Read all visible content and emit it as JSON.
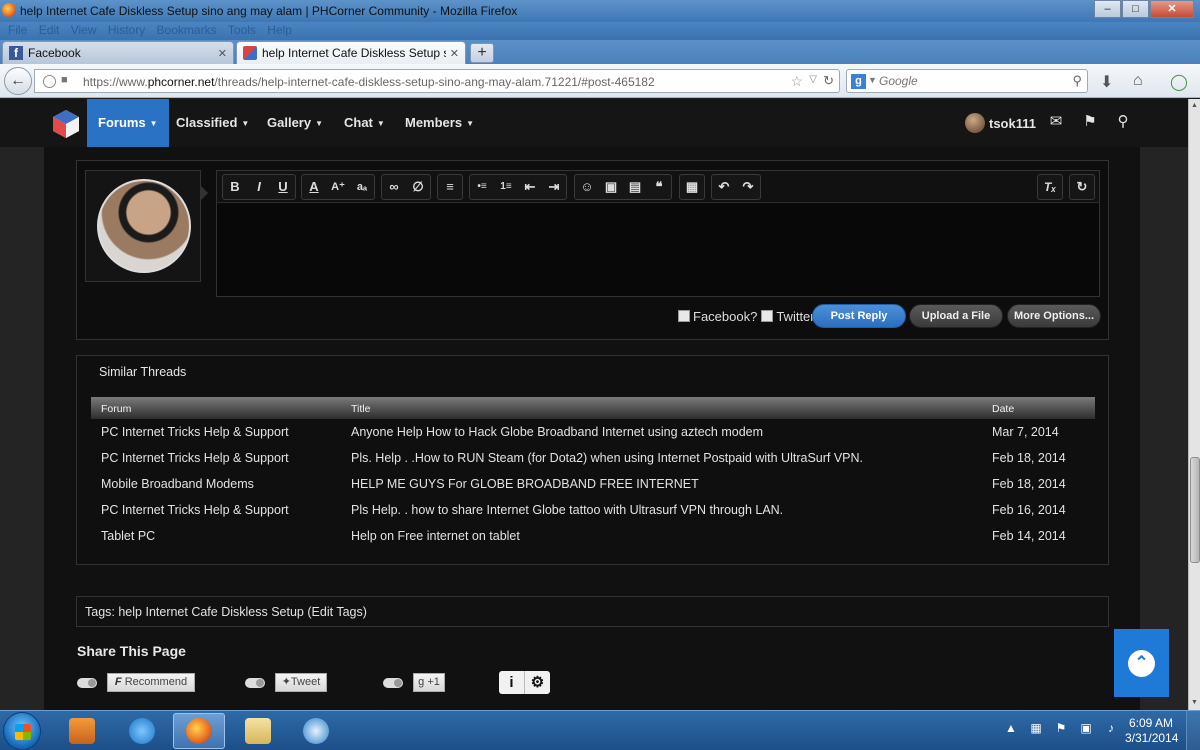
{
  "window": {
    "title": "help Internet Cafe Diskless Setup sino ang may alam | PHCorner Community - Mozilla Firefox",
    "controls": [
      "–",
      "□",
      "✕"
    ]
  },
  "menubar": [
    "File",
    "Edit",
    "View",
    "History",
    "Bookmarks",
    "Tools",
    "Help"
  ],
  "tabs": [
    {
      "label": "Facebook",
      "close": "✕"
    },
    {
      "label": "help Internet Cafe Diskless Setup sino...",
      "close": "✕"
    }
  ],
  "newtab_label": "+",
  "urlbar": {
    "prefix": "https://www.",
    "domain": "phcorner.net",
    "path": "/threads/help-internet-cafe-diskless-setup-sino-ang-may-alam.71221/#post-465182"
  },
  "search": {
    "placeholder": "Google",
    "engine_letter": "g"
  },
  "sitenav": {
    "items": [
      {
        "label": "Forums",
        "caret": "▼"
      },
      {
        "label": "Classified",
        "caret": "▼"
      },
      {
        "label": "Gallery",
        "caret": "▼"
      },
      {
        "label": "Chat",
        "caret": "▼"
      },
      {
        "label": "Members",
        "caret": "▼"
      }
    ],
    "username": "tsok111"
  },
  "editor": {
    "toolbar": {
      "bold": "B",
      "italic": "I",
      "underline": "U",
      "text_color": "A",
      "font_size": "A⁺",
      "font_family": "aₐ",
      "link": "∞",
      "unlink": "∅",
      "align": "≡",
      "bullet_list": "•≡",
      "numbered_list": "1≡",
      "outdent": "⇤",
      "indent": "⇥",
      "smilie": "☺",
      "image": "▣",
      "media": "▤",
      "quote": "❝",
      "save_draft": "▦",
      "undo": "↶",
      "redo": "↷",
      "remove_format": "Tₓ",
      "toggle_bbcode": "↻"
    },
    "facebook_label": "Facebook?",
    "twitter_label": "Twitter",
    "post_reply": "Post Reply",
    "upload_file": "Upload a File",
    "more_options": "More Options..."
  },
  "similar_threads": {
    "title": "Similar Threads",
    "headers": {
      "forum": "Forum",
      "title": "Title",
      "date": "Date"
    },
    "rows": [
      {
        "forum": "PC Internet Tricks Help & Support",
        "title": "Anyone Help How to Hack Globe Broadband Internet using aztech modem",
        "date": "Mar 7, 2014"
      },
      {
        "forum": "PC Internet Tricks Help & Support",
        "title": "Pls. Help . .How to RUN Steam (for Dota2) when using Internet Postpaid with UltraSurf VPN.",
        "date": "Feb 18, 2014"
      },
      {
        "forum": "Mobile Broadband Modems",
        "title": "HELP ME GUYS For GLOBE BROADBAND FREE INTERNET",
        "date": "Feb 18, 2014"
      },
      {
        "forum": "PC Internet Tricks Help & Support",
        "title": "Pls Help. . how to share Internet Globe tattoo with Ultrasurf VPN through LAN.",
        "date": "Feb 16, 2014"
      },
      {
        "forum": "Tablet PC",
        "title": "Help on Free internet on tablet",
        "date": "Feb 14, 2014"
      }
    ]
  },
  "tags": {
    "prefix": "Tags: ",
    "tag": "help Internet Cafe Diskless Setup",
    "edit": "(Edit Tags)"
  },
  "share": {
    "title": "Share This Page",
    "recommend": "Recommend",
    "tweet": "Tweet",
    "plusone": "+1",
    "info": "i",
    "settings": "⚙"
  },
  "scroll_top_icon": "⌃",
  "taskbar": {
    "time": "6:09 AM",
    "date": "3/31/2014"
  },
  "colors": {
    "accent": "#2a73c4",
    "page_bg": "#111111",
    "nav_bg": "#151515"
  }
}
